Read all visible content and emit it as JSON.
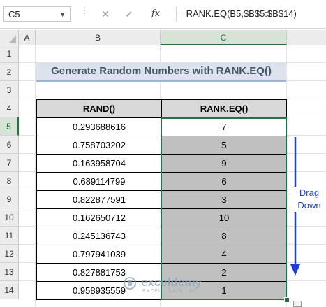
{
  "formula_bar": {
    "name_box": "C5",
    "cancel_glyph": "✕",
    "enter_glyph": "✓",
    "fx_label": "fx",
    "formula": "=RANK.EQ(B5,$B$5:$B$14)"
  },
  "columns": [
    "A",
    "B",
    "C"
  ],
  "rows": [
    "1",
    "2",
    "3",
    "4",
    "5",
    "6",
    "7",
    "8",
    "9",
    "10",
    "11",
    "12",
    "13",
    "14"
  ],
  "title": "Generate Random Numbers with RANK.EQ()",
  "table": {
    "headers": [
      "RAND()",
      "RANK.EQ()"
    ],
    "rows": [
      {
        "rand": "0.293688616",
        "rank": "7"
      },
      {
        "rand": "0.758703202",
        "rank": "5"
      },
      {
        "rand": "0.163958704",
        "rank": "9"
      },
      {
        "rand": "0.689114799",
        "rank": "6"
      },
      {
        "rand": "0.822877591",
        "rank": "3"
      },
      {
        "rand": "0.162650712",
        "rank": "10"
      },
      {
        "rand": "0.245136743",
        "rank": "8"
      },
      {
        "rand": "0.797941039",
        "rank": "4"
      },
      {
        "rand": "0.827881753",
        "rank": "2"
      },
      {
        "rand": "0.958935559",
        "rank": "1"
      }
    ]
  },
  "annotation": {
    "line1": "Drag",
    "line2": "Down",
    "color": "#1f3fd0"
  },
  "watermark": {
    "name": "exceldemy",
    "tagline": "EXCEL · DATA · BI"
  },
  "colors": {
    "selection": "#217346",
    "title_bg": "#dde3ec",
    "filled_cells": "#c0c0c0"
  }
}
